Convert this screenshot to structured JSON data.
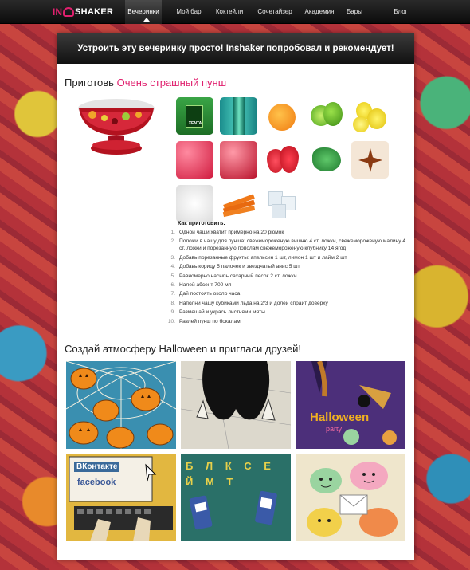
{
  "nav": {
    "logo_in": "IN",
    "logo_shaker": "SHAKER",
    "items": [
      "Вечеринки",
      "Мой бар",
      "Коктейли",
      "Сочетайзер",
      "Академия",
      "Бары",
      "Блог"
    ],
    "active_index": 0
  },
  "banner": {
    "text": "Устроить эту вечеринку просто! Inshaker попробовал и рекомендует!"
  },
  "recipe": {
    "heading_prefix": "Приготовь",
    "heading_name": "Очень страшный пунш",
    "ingredients": [
      "Xenta absenta",
      "Sprite bottle",
      "Orange",
      "Lime",
      "Lemon",
      "Frozen raspberries",
      "Frozen cherries",
      "Strawberries",
      "Mint leaves",
      "Star anise and cinnamon",
      "Sugar",
      "Carrot sticks",
      "Ice cubes"
    ],
    "ingredient_label_xenta": "XENTA",
    "howto_title": "Как приготовить:",
    "steps": [
      "Одной чаши хватит примерно на 20 рюмок",
      "Положи в чашу для пунша: свежемороженую вишню 4 ст. ложки, свежемороженую малину 4 ст. ложки и порезанную пополам свежемороженую клубнику 14 ягод",
      "Добавь порезанные фрукты: апельсин 1 шт, лимон 1 шт и лайм 2 шт",
      "Добавь корицу 5 палочек и звездчатый анис 5 шт",
      "Равномерно насыпь сахарный песок 2 ст. ложки",
      "Налей абсент 700 мл",
      "Дай постоять около часа",
      "Наполни чашу кубиками льда на 2/3 и долей спрайт доверху",
      "Размешай и укрась листьями мяты",
      "Разлей пунш по бокалам"
    ]
  },
  "party": {
    "heading": "Создай атмосферу Halloween и пригласи друзей!",
    "halloween_word": "Halloween",
    "party_word": "party",
    "vk_text": "ВКонтакте",
    "facebook_text": "facebook",
    "letters_text": "Б Л К С Е Й М Т"
  },
  "colors": {
    "accent": "#e0206e",
    "nav_bg": "#111111"
  }
}
